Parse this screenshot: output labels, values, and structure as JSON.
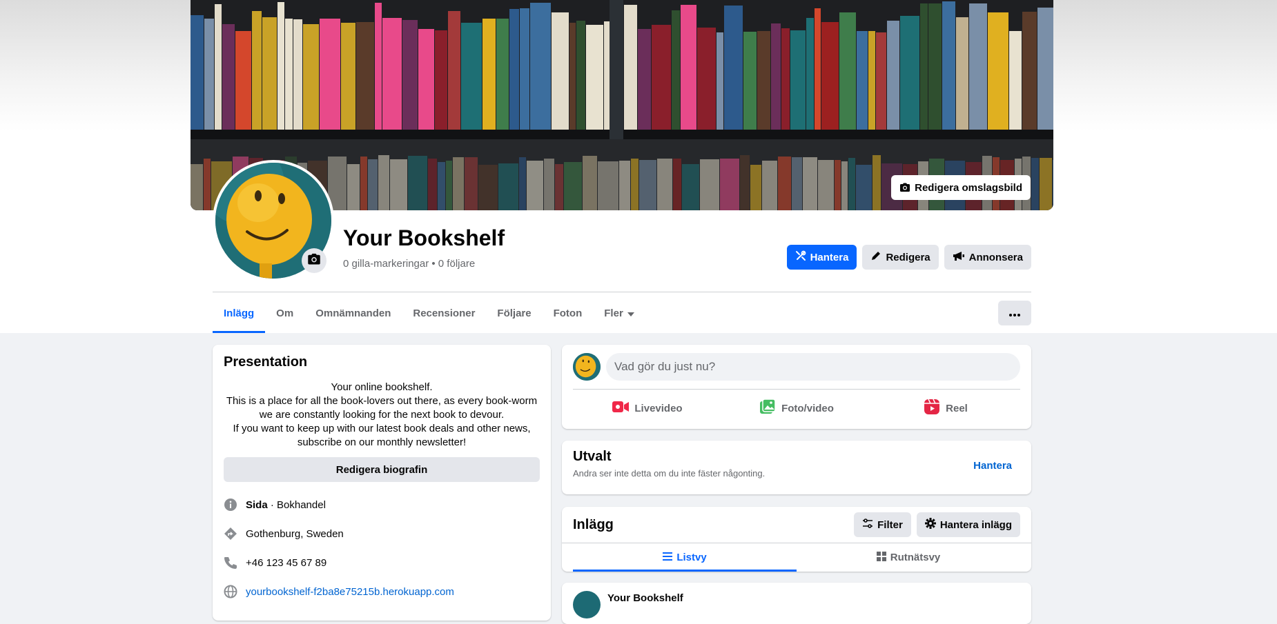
{
  "cover": {
    "edit_label": "Redigera omslagsbild"
  },
  "profile": {
    "name": "Your Bookshelf",
    "stats": "0 gilla-markeringar • 0 följare"
  },
  "actions": {
    "manage": "Hantera",
    "edit": "Redigera",
    "advertise": "Annonsera"
  },
  "tabs": [
    {
      "label": "Inlägg",
      "active": true
    },
    {
      "label": "Om"
    },
    {
      "label": "Omnämnanden"
    },
    {
      "label": "Recensioner"
    },
    {
      "label": "Följare"
    },
    {
      "label": "Foton"
    },
    {
      "label": "Fler"
    }
  ],
  "intro": {
    "title": "Presentation",
    "bio_lines": [
      "Your online bookshelf.",
      "This is a place for all the book-lovers out there, as every book-worm",
      "we are constantly looking for the next book to devour.",
      "If you want to keep up with our latest book deals and other news,",
      "subscribe on our monthly newsletter!"
    ],
    "edit_bio": "Redigera biografin",
    "page_type_bold": "Sida",
    "page_type_rest": " · Bokhandel",
    "location": "Gothenburg, Sweden",
    "phone": "+46 123 45 67 89",
    "website": "yourbookshelf-f2ba8e75215b.herokuapp.com"
  },
  "composer": {
    "placeholder": "Vad gör du just nu?",
    "live": "Livevideo",
    "photo": "Foto/video",
    "reel": "Reel"
  },
  "featured": {
    "title": "Utvalt",
    "subtitle": "Andra ser inte detta om du inte fäster någonting.",
    "manage": "Hantera"
  },
  "posts": {
    "title": "Inlägg",
    "filter": "Filter",
    "manage": "Hantera inlägg",
    "list_view": "Listvy",
    "grid_view": "Rutnätsvy",
    "author": "Your Bookshelf"
  },
  "colors": {
    "accent": "#0866ff",
    "link": "#0064d1",
    "live": "#f02849",
    "photo": "#45bd62",
    "reel": "#e42645"
  }
}
